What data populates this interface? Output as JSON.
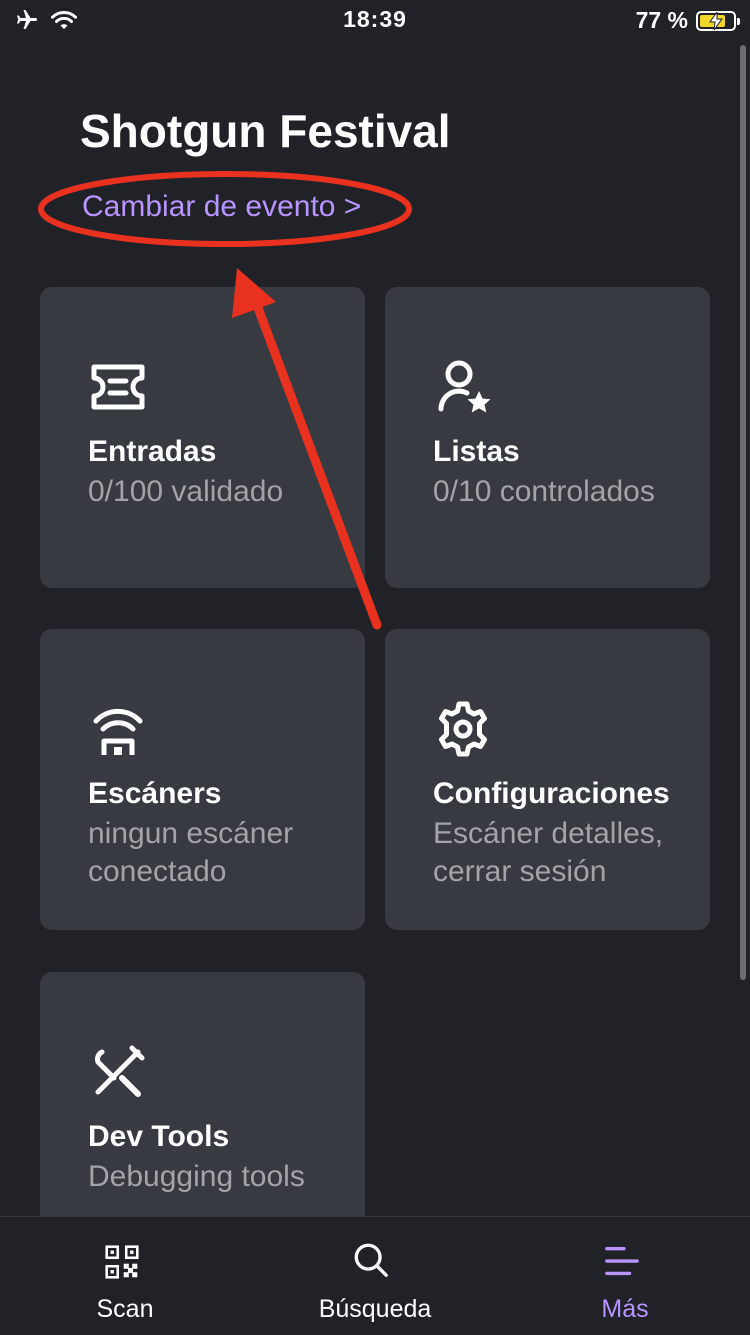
{
  "status_bar": {
    "time": "18:39",
    "battery": "77 %",
    "battery_level": 0.77,
    "icons": [
      "airplane-icon",
      "wifi-icon",
      "battery-charging-icon"
    ]
  },
  "header": {
    "title": "Shotgun Festival",
    "change_event_link": "Cambiar de evento >"
  },
  "cards": [
    {
      "icon": "ticket-icon",
      "label": "Entradas",
      "sub": "0/100 validado"
    },
    {
      "icon": "user-star-icon",
      "label": "Listas",
      "sub": "0/10 controlados"
    },
    {
      "icon": "scanner-icon",
      "label": "Escáners",
      "sub": "ningun escáner conectado"
    },
    {
      "icon": "gear-icon",
      "label": "Configuraciones",
      "sub": "Escáner detalles, cerrar sesión"
    },
    {
      "icon": "tools-icon",
      "label": "Dev Tools",
      "sub": "Debugging tools"
    }
  ],
  "tab_bar": {
    "tabs": [
      {
        "icon": "qr-code-icon",
        "label": "Scan",
        "active": false
      },
      {
        "icon": "search-icon",
        "label": "Búsqueda",
        "active": false
      },
      {
        "icon": "menu-icon",
        "label": "Más",
        "active": true
      }
    ]
  },
  "colors": {
    "background": "#202228",
    "card": "#373a40",
    "accent": "#b994ff",
    "annotation": "#e8311f",
    "secondary_text": "#a2a4a8"
  }
}
